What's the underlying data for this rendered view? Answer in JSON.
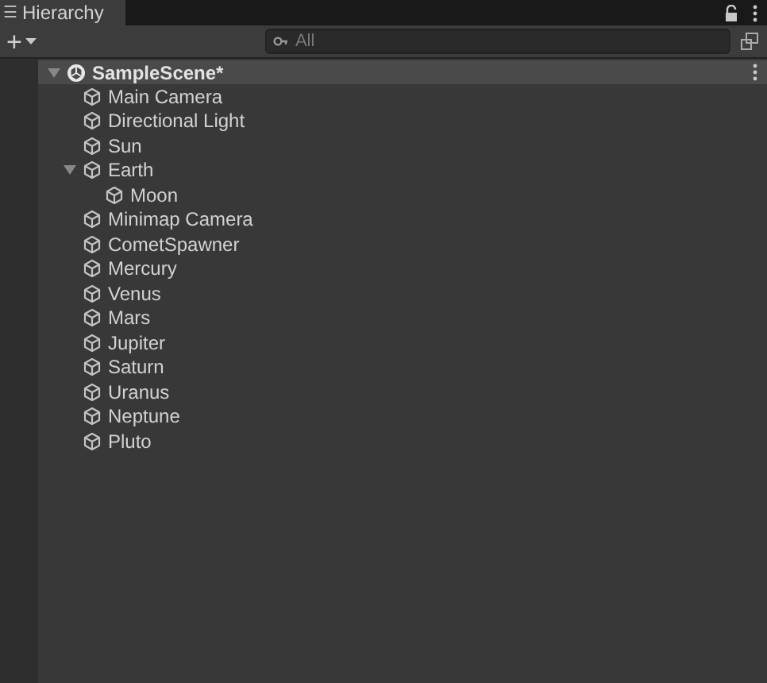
{
  "window": {
    "tab_icon": "☰",
    "title": "Hierarchy"
  },
  "toolbar": {
    "add": "+",
    "search": {
      "placeholder": "All"
    }
  },
  "scene": {
    "name": "SampleScene*",
    "expanded": true,
    "children": [
      {
        "name": "Main Camera"
      },
      {
        "name": "Directional Light"
      },
      {
        "name": "Sun"
      },
      {
        "name": "Earth",
        "expanded": true,
        "children": [
          {
            "name": "Moon"
          }
        ]
      },
      {
        "name": "Minimap Camera"
      },
      {
        "name": "CometSpawner"
      },
      {
        "name": "Mercury"
      },
      {
        "name": "Venus"
      },
      {
        "name": "Mars"
      },
      {
        "name": "Jupiter"
      },
      {
        "name": "Saturn"
      },
      {
        "name": "Uranus"
      },
      {
        "name": "Neptune"
      },
      {
        "name": "Pluto"
      }
    ]
  }
}
